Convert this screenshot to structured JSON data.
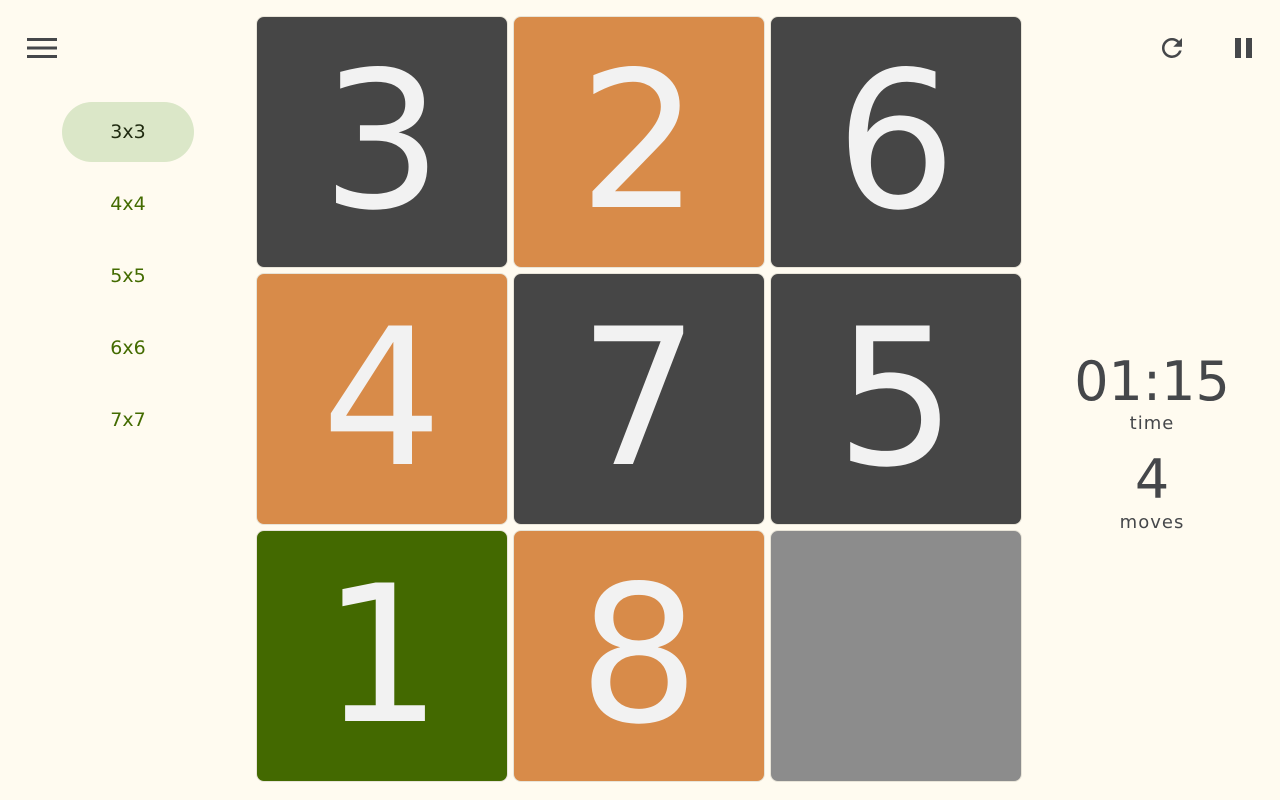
{
  "sidebar": {
    "sizes": [
      {
        "label": "3x3",
        "selected": true
      },
      {
        "label": "4x4",
        "selected": false
      },
      {
        "label": "5x5",
        "selected": false
      },
      {
        "label": "6x6",
        "selected": false
      },
      {
        "label": "7x7",
        "selected": false
      }
    ]
  },
  "board": {
    "grid_size": 3,
    "tiles": [
      {
        "value": "3",
        "color": "dark"
      },
      {
        "value": "2",
        "color": "orange"
      },
      {
        "value": "6",
        "color": "dark"
      },
      {
        "value": "4",
        "color": "orange"
      },
      {
        "value": "7",
        "color": "dark"
      },
      {
        "value": "5",
        "color": "dark"
      },
      {
        "value": "1",
        "color": "green"
      },
      {
        "value": "8",
        "color": "orange"
      },
      {
        "value": "",
        "color": "empty"
      }
    ]
  },
  "stats": {
    "time_value": "01:15",
    "time_label": "time",
    "moves_value": "4",
    "moves_label": "moves"
  },
  "icons": {
    "menu": "menu-icon",
    "refresh": "refresh-icon",
    "pause": "pause-icon"
  },
  "colors": {
    "background": "#fffbf0",
    "dark_tile": "#464646",
    "orange_tile": "#d88b49",
    "green_tile": "#436900",
    "empty_tile": "#8c8c8c",
    "accent_text": "#436b00",
    "selected_pill": "#dbe7c8"
  }
}
